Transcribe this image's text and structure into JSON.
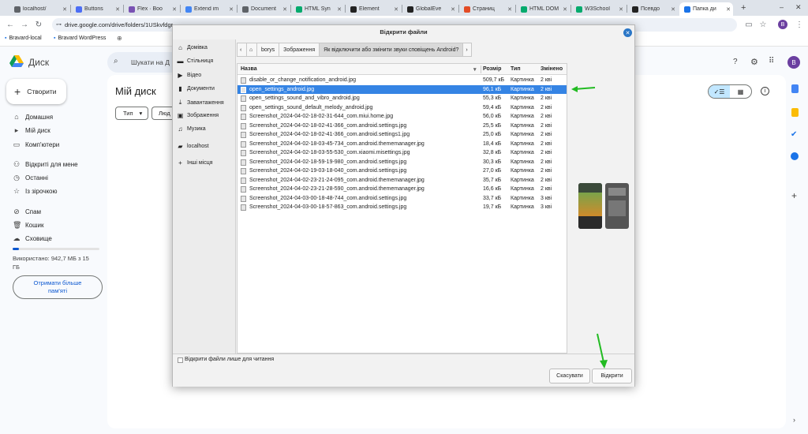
{
  "browser": {
    "tabs": [
      {
        "label": "localhost/",
        "color": "#5f6368"
      },
      {
        "label": "Buttons",
        "color": "#4c6ef5"
      },
      {
        "label": "Flex · Boo",
        "color": "#7952b3"
      },
      {
        "label": "Extend im",
        "color": "#4285f4"
      },
      {
        "label": "Document",
        "color": "#5f6368"
      },
      {
        "label": "HTML Syn",
        "color": "#04aa6d"
      },
      {
        "label": "Element",
        "color": "#222222"
      },
      {
        "label": "GlobalEve",
        "color": "#222222"
      },
      {
        "label": "Страниц",
        "color": "#e34c26"
      },
      {
        "label": "HTML DOM",
        "color": "#04aa6d"
      },
      {
        "label": "W3School",
        "color": "#04aa6d"
      },
      {
        "label": "Псевдо",
        "color": "#222222"
      },
      {
        "label": "Папка ди",
        "color": "#1a73e8"
      }
    ],
    "url": "drive.google.com/drive/folders/1USkvfdgr...",
    "bookmarks": [
      "Bravard-local",
      "Bravard WordPress"
    ]
  },
  "drive": {
    "product": "Диск",
    "create": "Створити",
    "search_placeholder": "Шукати на Д",
    "page_title": "Мій диск",
    "filter_type": "Тип",
    "filter_people": "Люд",
    "nav": [
      "Домашня",
      "Мій диск",
      "Комп'ютери",
      "Відкриті для мене",
      "Останні",
      "Із зірочкою",
      "Спам",
      "Кошик",
      "Сховище"
    ],
    "storage_used": "Використано: 942,7 МБ з 15 ГБ",
    "get_more": "Отримати більше пам'яті",
    "avatar": "B"
  },
  "dialog": {
    "title": "Відкрити файли",
    "places": [
      "Домівка",
      "Стільниця",
      "Відео",
      "Документи",
      "Завантаження",
      "Зображення",
      "Музика",
      "localhost",
      "Інші місця"
    ],
    "path": [
      "borys",
      "Зображення",
      "Як відключити або змінити звуки сповіщень Android?"
    ],
    "columns": {
      "name": "Назва",
      "size": "Розмір",
      "type": "Тип",
      "changed": "Змінено"
    },
    "files": [
      {
        "name": "disable_or_change_notification_android.jpg",
        "size": "509,7 кБ",
        "type": "Картинка",
        "changed": "2 кві"
      },
      {
        "name": "open_settings_android.jpg",
        "size": "96,1 кБ",
        "type": "Картинка",
        "changed": "2 кві"
      },
      {
        "name": "open_settings_sound_and_vibro_android.jpg",
        "size": "55,3 кБ",
        "type": "Картинка",
        "changed": "2 кві"
      },
      {
        "name": "open_settings_sound_default_melody_android.jpg",
        "size": "59,4 кБ",
        "type": "Картинка",
        "changed": "2 кві"
      },
      {
        "name": "Screenshot_2024-04-02-18-02-31-644_com.miui.home.jpg",
        "size": "56,0 кБ",
        "type": "Картинка",
        "changed": "2 кві"
      },
      {
        "name": "Screenshot_2024-04-02-18-02-41-366_com.android.settings.jpg",
        "size": "25,5 кБ",
        "type": "Картинка",
        "changed": "2 кві"
      },
      {
        "name": "Screenshot_2024-04-02-18-02-41-366_com.android.settings1.jpg",
        "size": "25,0 кБ",
        "type": "Картинка",
        "changed": "2 кві"
      },
      {
        "name": "Screenshot_2024-04-02-18-03-45-734_com.android.thememanager.jpg",
        "size": "18,4 кБ",
        "type": "Картинка",
        "changed": "2 кві"
      },
      {
        "name": "Screenshot_2024-04-02-18-03-55-530_com.xiaomi.misettings.jpg",
        "size": "32,8 кБ",
        "type": "Картинка",
        "changed": "2 кві"
      },
      {
        "name": "Screenshot_2024-04-02-18-59-19-980_com.android.settings.jpg",
        "size": "30,3 кБ",
        "type": "Картинка",
        "changed": "2 кві"
      },
      {
        "name": "Screenshot_2024-04-02-19-03-18-040_com.android.settings.jpg",
        "size": "27,0 кБ",
        "type": "Картинка",
        "changed": "2 кві"
      },
      {
        "name": "Screenshot_2024-04-02-23-21-24-095_com.android.thememanager.jpg",
        "size": "35,7 кБ",
        "type": "Картинка",
        "changed": "2 кві"
      },
      {
        "name": "Screenshot_2024-04-02-23-21-28-590_com.android.thememanager.jpg",
        "size": "16,6 кБ",
        "type": "Картинка",
        "changed": "2 кві"
      },
      {
        "name": "Screenshot_2024-04-03-00-18-48-744_com.android.settings.jpg",
        "size": "33,7 кБ",
        "type": "Картинка",
        "changed": "3 кві"
      },
      {
        "name": "Screenshot_2024-04-03-00-18-57-863_com.android.settings.jpg",
        "size": "19,7 кБ",
        "type": "Картинка",
        "changed": "3 кві"
      }
    ],
    "selected_index": 1,
    "readonly_label": "Відкрити файли лише для читання",
    "cancel": "Скасувати",
    "open": "Відкрити"
  },
  "colors": {
    "accent": "#3584e4",
    "arrow": "#22bb22",
    "drive_blue": "#0b57d0"
  }
}
